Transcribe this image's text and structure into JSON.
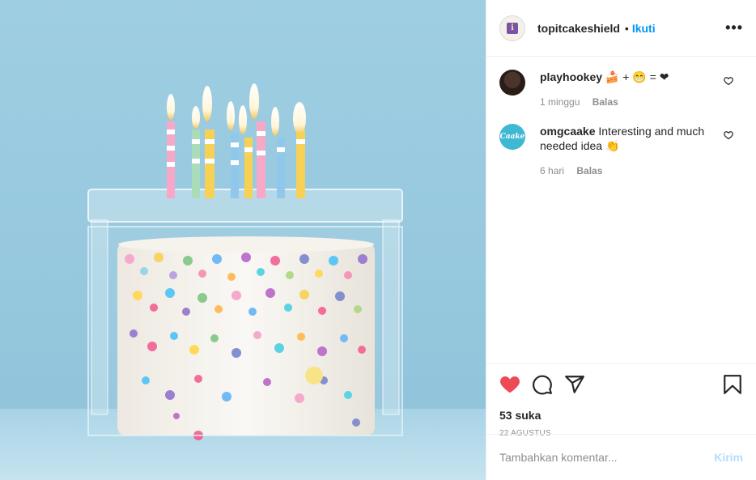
{
  "post": {
    "media_alt": "Birthday cake with candles under a clear cake shield",
    "author": {
      "username": "topitcakeshield",
      "separator": "•",
      "follow_label": "Ikuti",
      "avatar_letter": "i"
    },
    "more_icon": "more-horizontal-icon",
    "comments": [
      {
        "username": "playhookey",
        "text": "🍰 + 😁 = ❤",
        "time": "1 minggu",
        "reply_label": "Balas"
      },
      {
        "username": "omgcaake",
        "text": "Interesting and much needed idea 👏",
        "time": "6 hari",
        "reply_label": "Balas",
        "avatar_text": "Caake"
      }
    ],
    "actions": {
      "liked": true,
      "like_color": "#ed4956",
      "icons": [
        "heart-filled-icon",
        "comment-icon",
        "share-icon",
        "bookmark-icon"
      ]
    },
    "likes_text": "53 suka",
    "date": "22 AGUSTUS",
    "add_comment": {
      "placeholder": "Tambahkan komentar...",
      "send_label": "Kirim"
    }
  }
}
